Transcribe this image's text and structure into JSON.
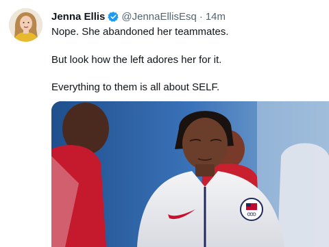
{
  "author": {
    "name": "Jenna Ellis",
    "handle": "@JennaEllisEsq",
    "separator": "·",
    "time": "14m",
    "avatar_icon": "profile-avatar",
    "verified_icon": "verified-badge-icon"
  },
  "tweet": {
    "lines": [
      "Nope. She abandoned her teammates.",
      "But look how the left adores her for it.",
      "Everything to them is all about SELF."
    ]
  },
  "media": {
    "kind": "photo",
    "subject_icon": "gymnasts-photo"
  },
  "colors": {
    "verified_blue": "#1d9bf0",
    "secondary_text": "#536471",
    "primary_text": "#0f1419"
  }
}
